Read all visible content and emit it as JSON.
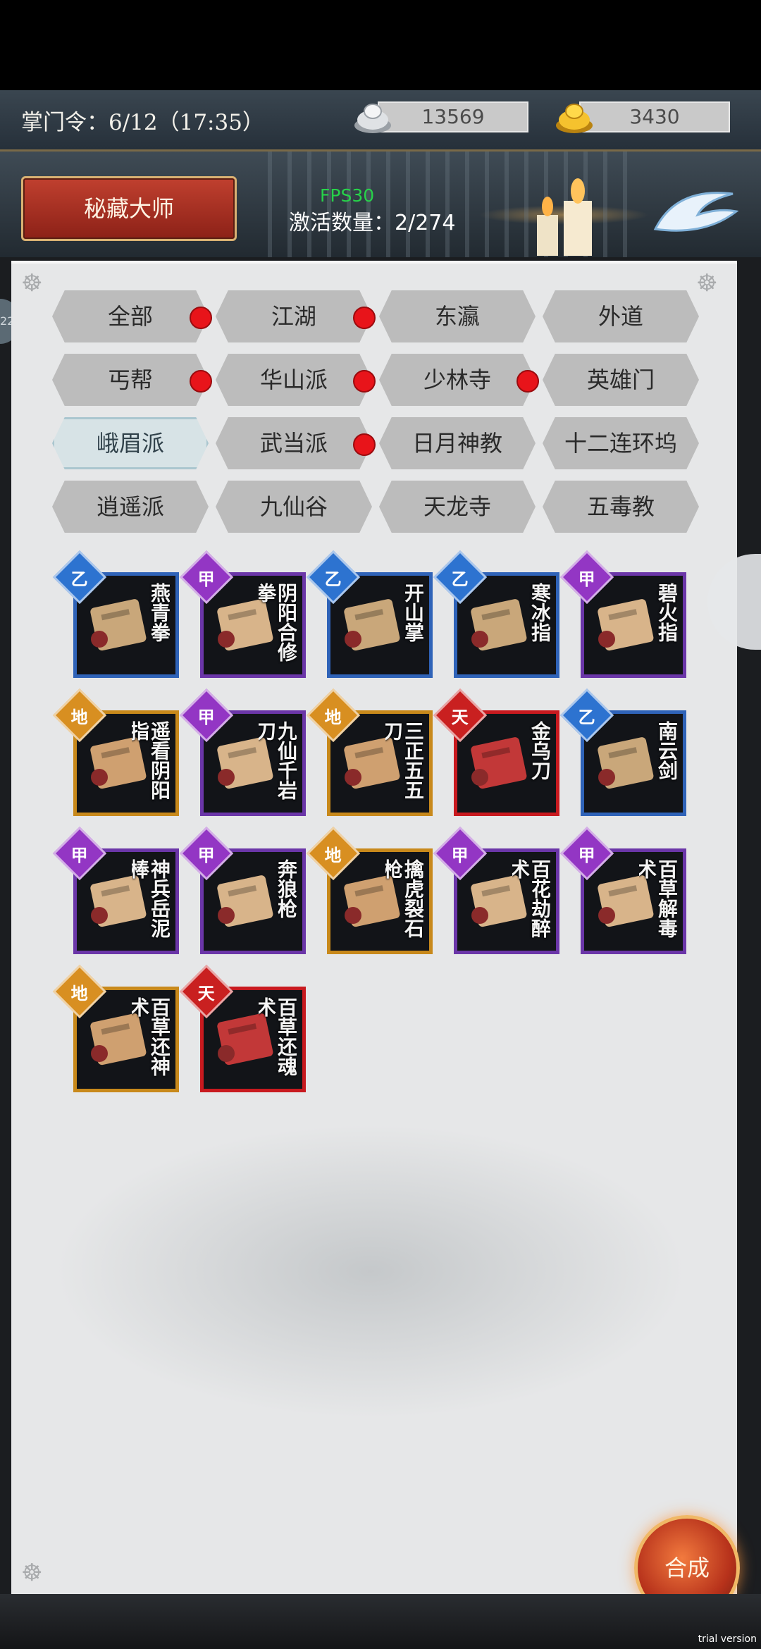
{
  "header": {
    "command_label": "掌门令：6/12（17:35）",
    "silver": "13569",
    "gold": "3430",
    "title": "秘藏大师",
    "fps": "FPS30",
    "activated": "激活数量：2/274"
  },
  "tabs": [
    {
      "label": "全部",
      "dot": true
    },
    {
      "label": "江湖",
      "dot": true
    },
    {
      "label": "东瀛",
      "dot": false
    },
    {
      "label": "外道",
      "dot": false
    },
    {
      "label": "丐帮",
      "dot": true
    },
    {
      "label": "华山派",
      "dot": true
    },
    {
      "label": "少林寺",
      "dot": true
    },
    {
      "label": "英雄门",
      "dot": false
    },
    {
      "label": "峨眉派",
      "dot": false,
      "active": true
    },
    {
      "label": "武当派",
      "dot": true
    },
    {
      "label": "日月神教",
      "dot": false
    },
    {
      "label": "十二连环坞",
      "dot": false
    },
    {
      "label": "逍遥派",
      "dot": false
    },
    {
      "label": "九仙谷",
      "dot": false
    },
    {
      "label": "天龙寺",
      "dot": false
    },
    {
      "label": "五毒教",
      "dot": false
    }
  ],
  "items": [
    {
      "grade": "乙",
      "color": "blue",
      "name": "燕青拳"
    },
    {
      "grade": "甲",
      "color": "purple",
      "name": "阴阳合修拳"
    },
    {
      "grade": "乙",
      "color": "blue",
      "name": "开山掌"
    },
    {
      "grade": "乙",
      "color": "blue",
      "name": "寒冰指"
    },
    {
      "grade": "甲",
      "color": "purple",
      "name": "碧火指"
    },
    {
      "grade": "地",
      "color": "gold",
      "name": "遥看阴阳指"
    },
    {
      "grade": "甲",
      "color": "purple",
      "name": "九仙千岩刀"
    },
    {
      "grade": "地",
      "color": "gold",
      "name": "三正五五刀"
    },
    {
      "grade": "天",
      "color": "red",
      "name": "金乌刀"
    },
    {
      "grade": "乙",
      "color": "blue",
      "name": "南云剑"
    },
    {
      "grade": "甲",
      "color": "purple",
      "name": "神兵岳泥棒"
    },
    {
      "grade": "甲",
      "color": "purple",
      "name": "奔狼枪"
    },
    {
      "grade": "地",
      "color": "gold",
      "name": "擒虎裂石枪"
    },
    {
      "grade": "甲",
      "color": "purple",
      "name": "百花劫醉术"
    },
    {
      "grade": "甲",
      "color": "purple",
      "name": "百草解毒术"
    },
    {
      "grade": "地",
      "color": "gold",
      "name": "百草还神术"
    },
    {
      "grade": "天",
      "color": "red",
      "name": "百草还魂术"
    }
  ],
  "side_badge": "22",
  "compose_label": "合成",
  "watermark": "trial version"
}
